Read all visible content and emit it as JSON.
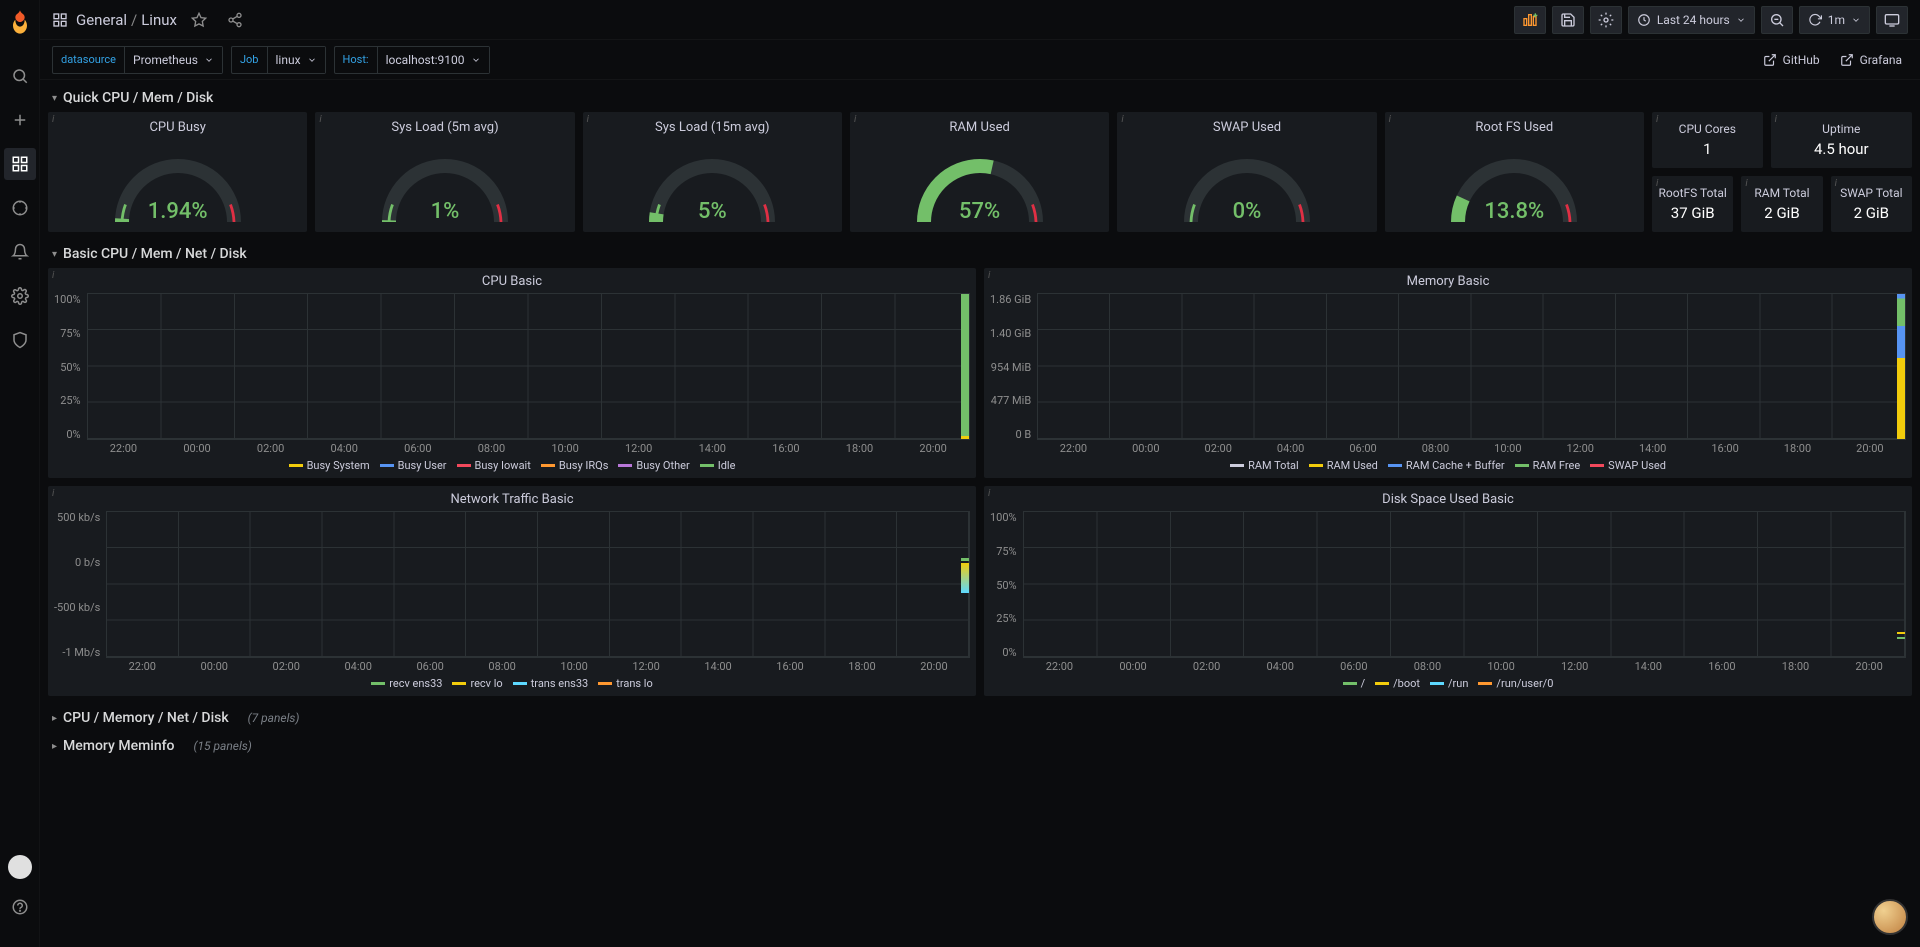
{
  "breadcrumb": {
    "root": "General",
    "dashboard": "Linux"
  },
  "topbar": {
    "time_range": "Last 24 hours",
    "refresh": "1m"
  },
  "vars": {
    "datasource_label": "datasource",
    "datasource_value": "Prometheus",
    "job_label": "Job",
    "job_value": "linux",
    "host_label": "Host:",
    "host_value": "localhost:9100"
  },
  "links": {
    "github": "GitHub",
    "grafana": "Grafana"
  },
  "rows": {
    "quick": "Quick CPU / Mem / Disk",
    "basic": "Basic CPU / Mem / Net / Disk",
    "cpu_mem": "CPU / Memory / Net / Disk",
    "cpu_mem_count": "(7 panels)",
    "meminfo": "Memory Meminfo",
    "meminfo_count": "(15 panels)"
  },
  "gauges": [
    {
      "title": "CPU Busy",
      "value": "1.94%",
      "pct": 1.94,
      "color": "#73BF69"
    },
    {
      "title": "Sys Load (5m avg)",
      "value": "1%",
      "pct": 1,
      "color": "#73BF69"
    },
    {
      "title": "Sys Load (15m avg)",
      "value": "5%",
      "pct": 5,
      "color": "#73BF69"
    },
    {
      "title": "RAM Used",
      "value": "57%",
      "pct": 57,
      "color": "#73BF69"
    },
    {
      "title": "SWAP Used",
      "value": "0%",
      "pct": 0,
      "color": "#73BF69"
    },
    {
      "title": "Root FS Used",
      "value": "13.8%",
      "pct": 13.8,
      "color": "#73BF69"
    }
  ],
  "stats": {
    "cpu_cores": {
      "title": "CPU Cores",
      "value": "1"
    },
    "uptime": {
      "title": "Uptime",
      "value": "4.5 hour"
    },
    "rootfs": {
      "title": "RootFS Total",
      "value": "37 GiB"
    },
    "ram": {
      "title": "RAM Total",
      "value": "2 GiB"
    },
    "swap": {
      "title": "SWAP Total",
      "value": "2 GiB"
    }
  },
  "time_ticks": [
    "22:00",
    "00:00",
    "02:00",
    "04:00",
    "06:00",
    "08:00",
    "10:00",
    "12:00",
    "14:00",
    "16:00",
    "18:00",
    "20:00"
  ],
  "charts": {
    "cpu": {
      "title": "CPU Basic",
      "y": [
        "100%",
        "75%",
        "50%",
        "25%",
        "0%"
      ],
      "legend": [
        {
          "name": "Busy System",
          "color": "#F2CC0C"
        },
        {
          "name": "Busy User",
          "color": "#5794F2"
        },
        {
          "name": "Busy Iowait",
          "color": "#F2495C"
        },
        {
          "name": "Busy IRQs",
          "color": "#FF9830"
        },
        {
          "name": "Busy Other",
          "color": "#B877D9"
        },
        {
          "name": "Idle",
          "color": "#73BF69"
        }
      ]
    },
    "mem": {
      "title": "Memory Basic",
      "y": [
        "1.86 GiB",
        "1.40 GiB",
        "954 MiB",
        "477 MiB",
        "0 B"
      ],
      "legend": [
        {
          "name": "RAM Total",
          "color": "#CCCCDC"
        },
        {
          "name": "RAM Used",
          "color": "#F2CC0C"
        },
        {
          "name": "RAM Cache + Buffer",
          "color": "#5794F2"
        },
        {
          "name": "RAM Free",
          "color": "#73BF69"
        },
        {
          "name": "SWAP Used",
          "color": "#F2495C"
        }
      ]
    },
    "net": {
      "title": "Network Traffic Basic",
      "y": [
        "500 kb/s",
        "0 b/s",
        "-500 kb/s",
        "-1 Mb/s"
      ],
      "legend": [
        {
          "name": "recv ens33",
          "color": "#73BF69"
        },
        {
          "name": "recv lo",
          "color": "#F2CC0C"
        },
        {
          "name": "trans ens33",
          "color": "#5DD8FF"
        },
        {
          "name": "trans lo",
          "color": "#FF9830"
        }
      ]
    },
    "disk": {
      "title": "Disk Space Used Basic",
      "y": [
        "100%",
        "75%",
        "50%",
        "25%",
        "0%"
      ],
      "legend": [
        {
          "name": "/",
          "color": "#73BF69"
        },
        {
          "name": "/boot",
          "color": "#F2CC0C"
        },
        {
          "name": "/run",
          "color": "#5DD8FF"
        },
        {
          "name": "/run/user/0",
          "color": "#FF9830"
        }
      ]
    }
  },
  "chart_data": [
    {
      "type": "area",
      "title": "CPU Basic",
      "ylabel": "",
      "ylim": [
        0,
        100
      ],
      "categories": [
        "22:00",
        "00:00",
        "02:00",
        "04:00",
        "06:00",
        "08:00",
        "10:00",
        "12:00",
        "14:00",
        "16:00",
        "18:00",
        "20:00"
      ],
      "series": [
        {
          "name": "Busy System",
          "values": [
            null,
            null,
            null,
            null,
            null,
            null,
            null,
            null,
            null,
            null,
            null,
            1
          ]
        },
        {
          "name": "Busy User",
          "values": [
            null,
            null,
            null,
            null,
            null,
            null,
            null,
            null,
            null,
            null,
            null,
            1
          ]
        },
        {
          "name": "Busy Iowait",
          "values": [
            null,
            null,
            null,
            null,
            null,
            null,
            null,
            null,
            null,
            null,
            null,
            0
          ]
        },
        {
          "name": "Busy IRQs",
          "values": [
            null,
            null,
            null,
            null,
            null,
            null,
            null,
            null,
            null,
            null,
            null,
            0
          ]
        },
        {
          "name": "Busy Other",
          "values": [
            null,
            null,
            null,
            null,
            null,
            null,
            null,
            null,
            null,
            null,
            null,
            0
          ]
        },
        {
          "name": "Idle",
          "values": [
            null,
            null,
            null,
            null,
            null,
            null,
            null,
            null,
            null,
            null,
            null,
            98
          ]
        }
      ]
    },
    {
      "type": "area",
      "title": "Memory Basic",
      "ylabel": "",
      "ylim": [
        0,
        1.86
      ],
      "categories": [
        "22:00",
        "00:00",
        "02:00",
        "04:00",
        "06:00",
        "08:00",
        "10:00",
        "12:00",
        "14:00",
        "16:00",
        "18:00",
        "20:00"
      ],
      "series": [
        {
          "name": "RAM Total (GiB)",
          "values": [
            null,
            null,
            null,
            null,
            null,
            null,
            null,
            null,
            null,
            null,
            null,
            1.86
          ]
        },
        {
          "name": "RAM Used (GiB)",
          "values": [
            null,
            null,
            null,
            null,
            null,
            null,
            null,
            null,
            null,
            null,
            null,
            1.06
          ]
        },
        {
          "name": "RAM Cache + Buffer (GiB)",
          "values": [
            null,
            null,
            null,
            null,
            null,
            null,
            null,
            null,
            null,
            null,
            null,
            0.42
          ]
        },
        {
          "name": "RAM Free (GiB)",
          "values": [
            null,
            null,
            null,
            null,
            null,
            null,
            null,
            null,
            null,
            null,
            null,
            0.38
          ]
        },
        {
          "name": "SWAP Used (GiB)",
          "values": [
            null,
            null,
            null,
            null,
            null,
            null,
            null,
            null,
            null,
            null,
            null,
            0
          ]
        }
      ]
    },
    {
      "type": "line",
      "title": "Network Traffic Basic",
      "ylabel": "",
      "ylim": [
        -1000,
        500
      ],
      "categories": [
        "22:00",
        "00:00",
        "02:00",
        "04:00",
        "06:00",
        "08:00",
        "10:00",
        "12:00",
        "14:00",
        "16:00",
        "18:00",
        "20:00"
      ],
      "series": [
        {
          "name": "recv ens33 (kb/s)",
          "values": [
            null,
            null,
            null,
            null,
            null,
            null,
            null,
            null,
            null,
            null,
            null,
            50
          ]
        },
        {
          "name": "recv lo (kb/s)",
          "values": [
            null,
            null,
            null,
            null,
            null,
            null,
            null,
            null,
            null,
            null,
            null,
            0
          ]
        },
        {
          "name": "trans ens33 (kb/s)",
          "values": [
            null,
            null,
            null,
            null,
            null,
            null,
            null,
            null,
            null,
            null,
            null,
            -520
          ]
        },
        {
          "name": "trans lo (kb/s)",
          "values": [
            null,
            null,
            null,
            null,
            null,
            null,
            null,
            null,
            null,
            null,
            null,
            0
          ]
        }
      ]
    },
    {
      "type": "line",
      "title": "Disk Space Used Basic",
      "ylabel": "",
      "ylim": [
        0,
        100
      ],
      "categories": [
        "22:00",
        "00:00",
        "02:00",
        "04:00",
        "06:00",
        "08:00",
        "10:00",
        "12:00",
        "14:00",
        "16:00",
        "18:00",
        "20:00"
      ],
      "series": [
        {
          "name": "/",
          "values": [
            null,
            null,
            null,
            null,
            null,
            null,
            null,
            null,
            null,
            null,
            null,
            14
          ]
        },
        {
          "name": "/boot",
          "values": [
            null,
            null,
            null,
            null,
            null,
            null,
            null,
            null,
            null,
            null,
            null,
            17
          ]
        },
        {
          "name": "/run",
          "values": [
            null,
            null,
            null,
            null,
            null,
            null,
            null,
            null,
            null,
            null,
            null,
            1
          ]
        },
        {
          "name": "/run/user/0",
          "values": [
            null,
            null,
            null,
            null,
            null,
            null,
            null,
            null,
            null,
            null,
            null,
            0
          ]
        }
      ]
    }
  ]
}
